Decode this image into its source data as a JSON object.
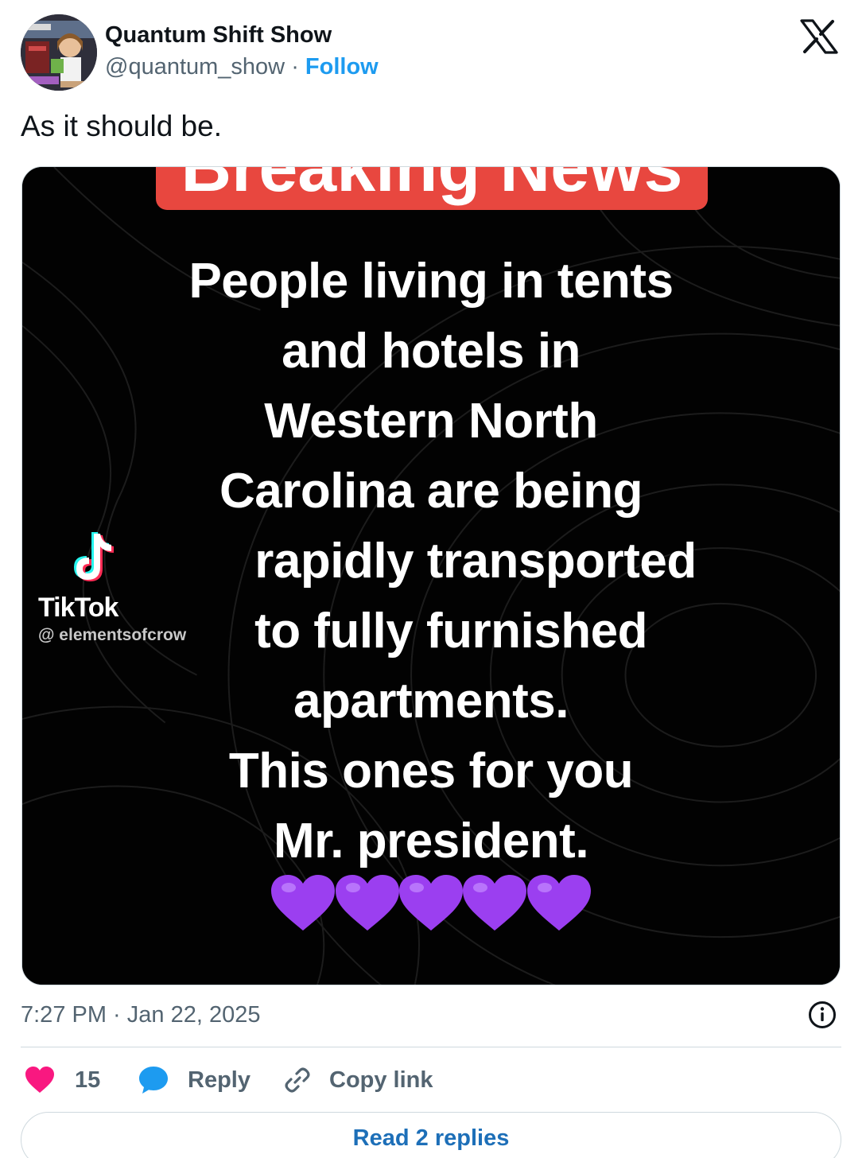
{
  "author": {
    "display_name": "Quantum Shift Show",
    "handle": "@quantum_show",
    "separator": "·",
    "follow_label": "Follow",
    "avatar_icon": "avatar-image"
  },
  "tweet": {
    "text": "As it should be."
  },
  "media": {
    "banner_text": "Breaking News",
    "lines": [
      "People living in tents",
      "and hotels in",
      "Western North",
      "Carolina are being",
      "rapidly transported",
      "to fully furnished",
      "apartments.",
      "This ones for you",
      "Mr. president."
    ],
    "hearts": [
      "💜",
      "💜",
      "💜",
      "💜",
      "💜"
    ],
    "heart_color": "#9b3ff0",
    "watermark": {
      "brand": "TikTok",
      "user": "@ elementsofcrow"
    }
  },
  "meta": {
    "timestamp": "7:27 PM · Jan 22, 2025"
  },
  "actions": {
    "like_count": "15",
    "reply_label": "Reply",
    "copy_label": "Copy link"
  },
  "footer": {
    "read_replies_label": "Read 2 replies"
  },
  "colors": {
    "like": "#f91880",
    "reply": "#1d9bf0",
    "follow": "#1d9bf0",
    "muted": "#536471"
  }
}
